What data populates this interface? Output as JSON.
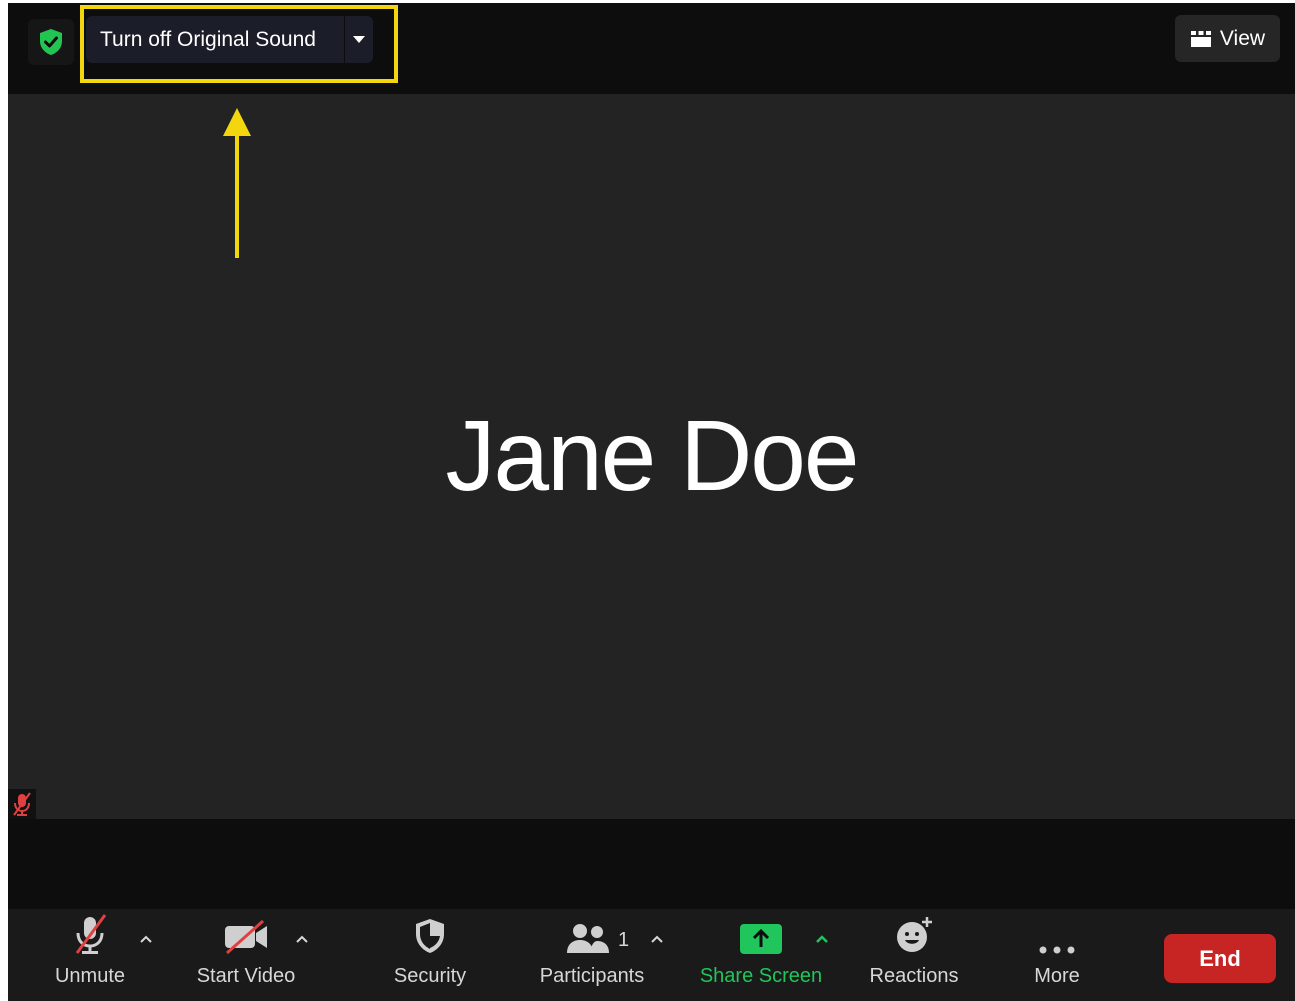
{
  "topbar": {
    "original_sound_label": "Turn off Original Sound",
    "view_label": "View"
  },
  "participant": {
    "name": "Jane Doe"
  },
  "toolbar": {
    "unmute_label": "Unmute",
    "start_video_label": "Start Video",
    "security_label": "Security",
    "participants_label": "Participants",
    "participants_count": "1",
    "share_screen_label": "Share Screen",
    "reactions_label": "Reactions",
    "more_label": "More",
    "end_label": "End"
  },
  "colors": {
    "highlight": "#f4d60f",
    "share_green": "#20c55b",
    "end_red": "#c72424",
    "shield_green": "#23c552",
    "muted_red": "#e04040"
  },
  "icons": [
    "shield-check-icon",
    "chevron-down-icon",
    "grid-view-icon",
    "arrow-up-icon",
    "mic-muted-icon",
    "video-off-icon",
    "security-shield-icon",
    "participants-icon",
    "share-screen-icon",
    "reactions-icon",
    "more-icon",
    "caret-up-icon"
  ]
}
